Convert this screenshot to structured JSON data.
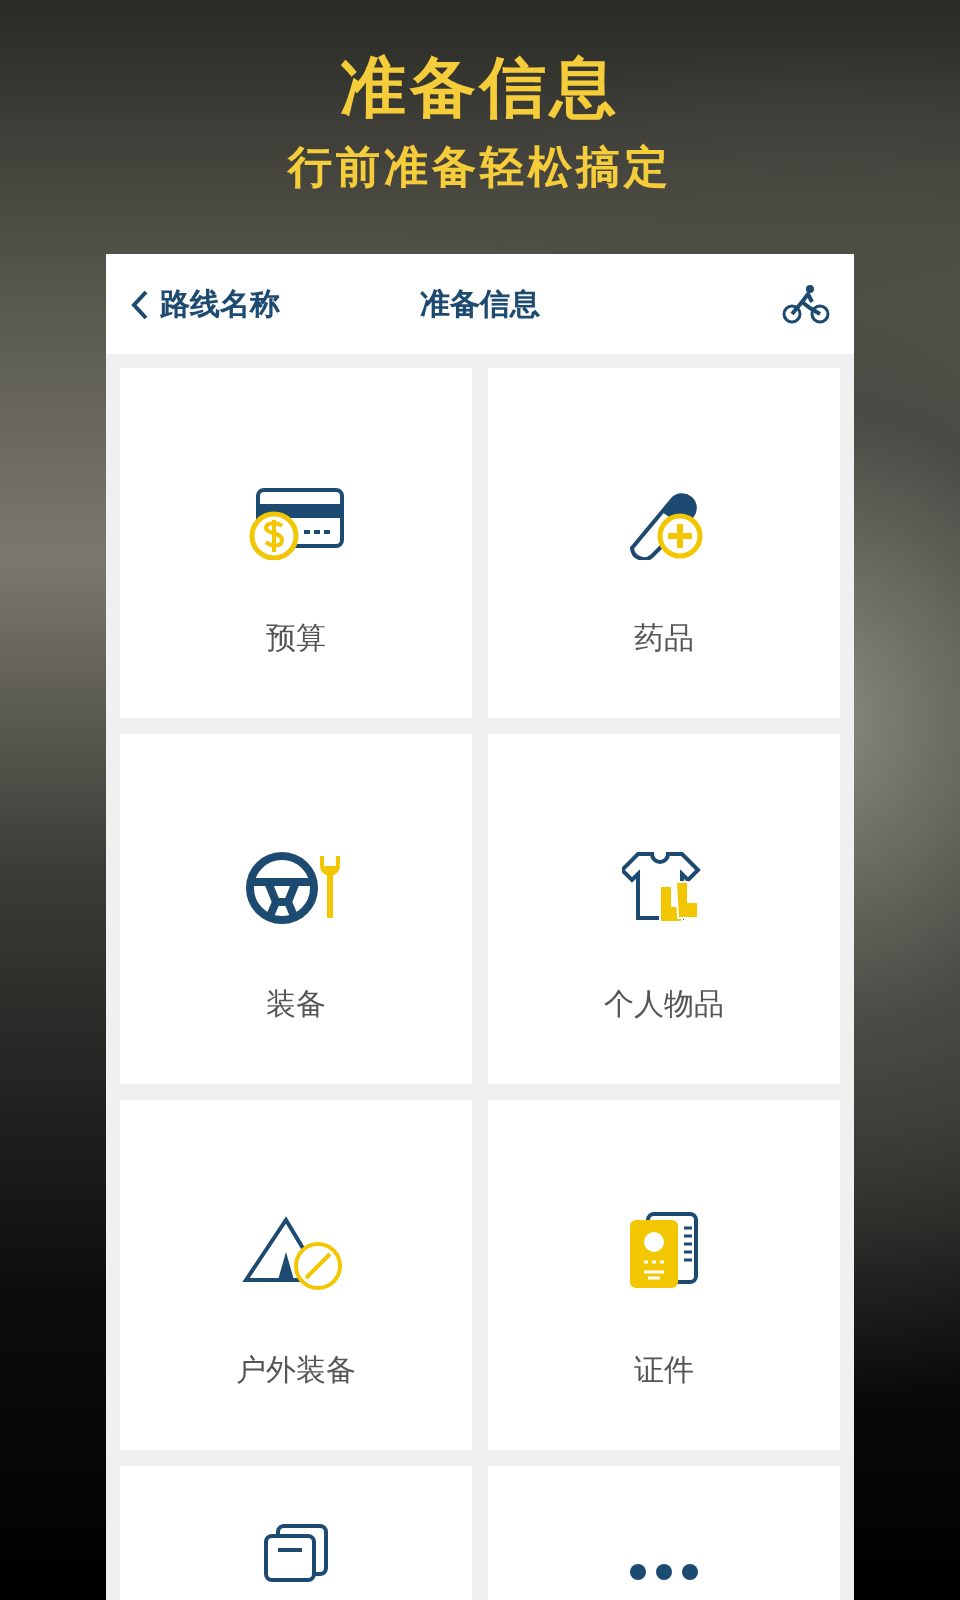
{
  "banner": {
    "title": "准备信息",
    "subtitle": "行前准备轻松搞定"
  },
  "header": {
    "back_label": "路线名称",
    "title": "准备信息"
  },
  "tiles": [
    {
      "kind": "budget",
      "label": "预算"
    },
    {
      "kind": "medicine",
      "label": "药品"
    },
    {
      "kind": "equipment",
      "label": "装备"
    },
    {
      "kind": "personal",
      "label": "个人物品"
    },
    {
      "kind": "outdoor",
      "label": "户外装备"
    },
    {
      "kind": "documents",
      "label": "证件"
    },
    {
      "kind": "papers"
    },
    {
      "kind": "more"
    }
  ]
}
